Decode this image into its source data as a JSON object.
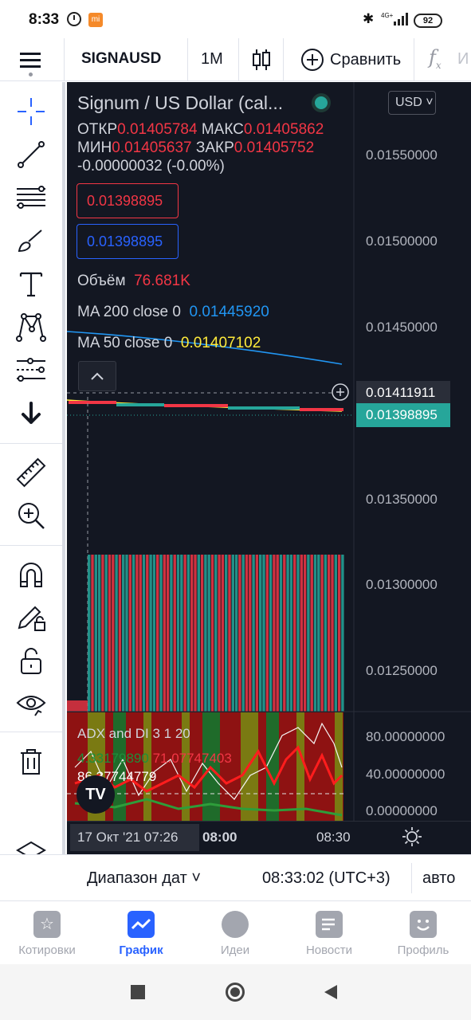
{
  "status": {
    "time": "8:33",
    "network": "4G+",
    "battery": "92"
  },
  "toolbar": {
    "symbol": "SIGNAUSD",
    "interval": "1M",
    "compare_label": "Сравнить",
    "indicators_hint": "И"
  },
  "chart": {
    "title": "Signum / US Dollar (cal...",
    "ohlc": {
      "open_label": "ОТКР",
      "open": "0.01405784",
      "high_label": "МАКС",
      "high": "0.01405862",
      "low_label": "МИН",
      "low": "0.01405637",
      "close_label": "ЗАКР",
      "close": "0.01405752",
      "change": "-0.00000032 (-0.00%)"
    },
    "sell_price": "0.01398895",
    "buy_price": "0.01398895",
    "volume_label": "Объём",
    "volume_value": "76.681K",
    "ma200_label": "MA 200 close 0",
    "ma200_value": "0.01445920",
    "ma50_label": "MA 50 close 0",
    "ma50_value": "0.01407102",
    "currency": "USD",
    "price_levels": [
      "0.01550000",
      "0.01500000",
      "0.01450000",
      "0.01350000",
      "0.01300000",
      "0.01250000"
    ],
    "crosshair_price": "0.01411911",
    "last_price": "0.01398895",
    "adx_label": "ADX and DI 3 1 20",
    "adx_plus_di": "4.33179890",
    "adx_minus_di": "71.07747403",
    "adx_value": "86.37744779",
    "adx_levels": [
      "80.00000000",
      "40.00000000",
      "0.00000000"
    ],
    "time_cursor": "17 Окт '21   07:26",
    "time_labels": [
      "08:00",
      "08:30"
    ]
  },
  "range_bar": {
    "range_label": "Диапазон дат",
    "clock": "08:33:02 (UTC+3)",
    "auto": "авто"
  },
  "bottom_nav": [
    {
      "label": "Котировки",
      "icon": "star-icon",
      "active": false
    },
    {
      "label": "График",
      "icon": "chart-icon",
      "active": true
    },
    {
      "label": "Идеи",
      "icon": "lightbulb-icon",
      "active": false
    },
    {
      "label": "Новости",
      "icon": "news-icon",
      "active": false
    },
    {
      "label": "Профиль",
      "icon": "smiley-icon",
      "active": false
    }
  ],
  "colors": {
    "chart_bg": "#131722",
    "red": "#f23645",
    "blue": "#2962ff",
    "teal": "#26a69a",
    "yellow": "#ffeb3b",
    "accent": "#2962ff"
  }
}
